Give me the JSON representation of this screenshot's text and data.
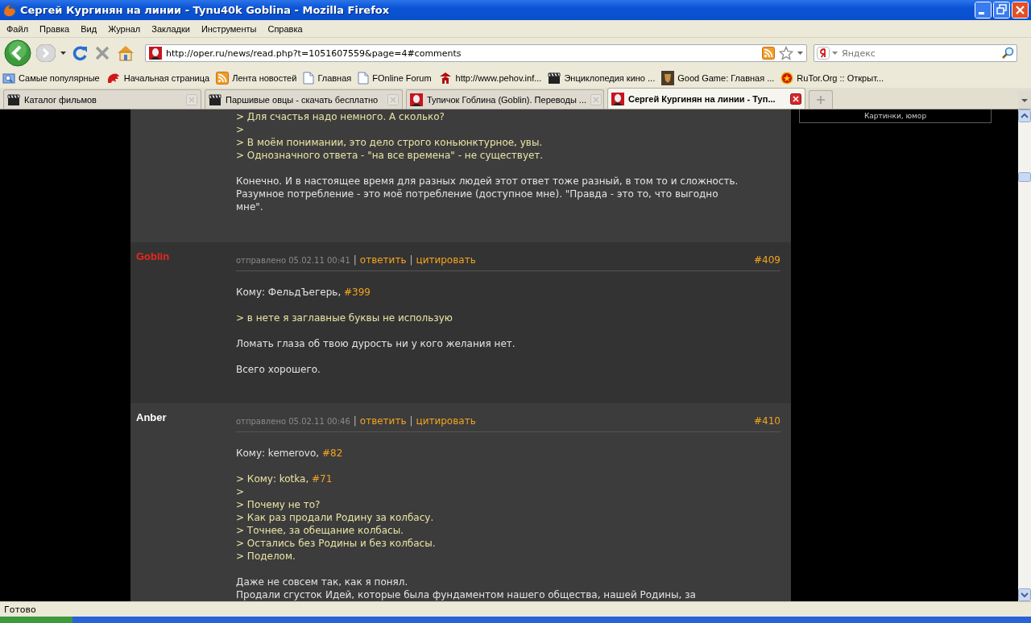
{
  "window": {
    "title": "Сергей Кургинян на линии - Tynu40k Goblina - Mozilla Firefox"
  },
  "menu": [
    "Файл",
    "Правка",
    "Вид",
    "Журнал",
    "Закладки",
    "Инструменты",
    "Справка"
  ],
  "address_bar": {
    "url": "http://oper.ru/news/read.php?t=1051607559&page=4#comments"
  },
  "search": {
    "placeholder": "Яндекс"
  },
  "bookmarks": [
    "Самые популярные",
    "Начальная страница",
    "Лента новостей",
    "Главная",
    "FOnline Forum",
    "http://www.pehov.inf...",
    "Энциклопедия кино ...",
    "Good Game: Главная ...",
    "RuTor.Org :: Открыт..."
  ],
  "tabs": [
    {
      "label": "Каталог фильмов",
      "selected": false
    },
    {
      "label": "Паршивые овцы - скачать бесплатно",
      "selected": false
    },
    {
      "label": "Тупичок Гоблина (Goblin). Переводы ...",
      "selected": false
    },
    {
      "label": "Сергей Кургинян на линии - Туп...",
      "selected": true
    }
  ],
  "sidebar": {
    "text": "Картинки, юмор"
  },
  "comments": [
    {
      "blocks": [
        {
          "kind": "quote",
          "lines": [
            {
              "text": "> Для счастья надо немного. А сколько?"
            },
            {
              "text": ">"
            },
            {
              "text": "> В моём понимании, это дело строго коньюнктурное, увы."
            },
            {
              "text": "> Однозначного ответа - \"на все времена\" - не существует."
            }
          ]
        },
        {
          "kind": "text",
          "lines": [
            {
              "text": "Конечно. И в настоящее время для разных людей этот ответ тоже разный, в том то и сложность."
            },
            {
              "text": "Разумное потребление - это моё потребление (доступное мне). \"Правда - это то, что выгодно"
            },
            {
              "text": "мне\"."
            }
          ]
        }
      ]
    },
    {
      "author": "Goblin",
      "color": "#e8281e",
      "posted": "отправлено 05.02.11 00:41",
      "separator": "|",
      "reply": "ответить",
      "quote": "цитировать",
      "number": "#409",
      "blocks": [
        {
          "kind": "text",
          "lines": [
            {
              "text": "Кому: ФельдЪегерь, ",
              "link": "#399"
            }
          ]
        },
        {
          "kind": "quote",
          "lines": [
            {
              "text": "> в нете я заглавные буквы не использую"
            }
          ]
        },
        {
          "kind": "text",
          "lines": [
            {
              "text": "Ломать глаза об твою дурость ни у кого желания нет."
            }
          ]
        },
        {
          "kind": "text",
          "lines": [
            {
              "text": "Всего хорошего."
            }
          ]
        }
      ]
    },
    {
      "author": "Anber",
      "color": "#ffffff",
      "posted": "отправлено 05.02.11 00:46",
      "separator": "|",
      "reply": "ответить",
      "quote": "цитировать",
      "number": "#410",
      "blocks": [
        {
          "kind": "text",
          "lines": [
            {
              "text": "Кому: kemerovo, ",
              "link": "#82"
            }
          ]
        },
        {
          "kind": "quote",
          "lines": [
            {
              "text": "> Кому: kotka, ",
              "link": "#71"
            },
            {
              "text": ">"
            },
            {
              "text": "> Почему не то?"
            },
            {
              "text": "> Как раз продали Родину за колбасу."
            },
            {
              "text": "> Точнее, за обещание колбасы."
            },
            {
              "text": "> Остались без Родины и без колбасы."
            },
            {
              "text": "> Поделом."
            }
          ]
        },
        {
          "kind": "text",
          "lines": [
            {
              "text": "Даже не совсем так, как я понял."
            },
            {
              "text": "Продали сгусток Идей, которые была фундаментом нашего общества, нашей Родины, за"
            }
          ]
        }
      ]
    }
  ],
  "status_bar": {
    "text": "Готово"
  }
}
